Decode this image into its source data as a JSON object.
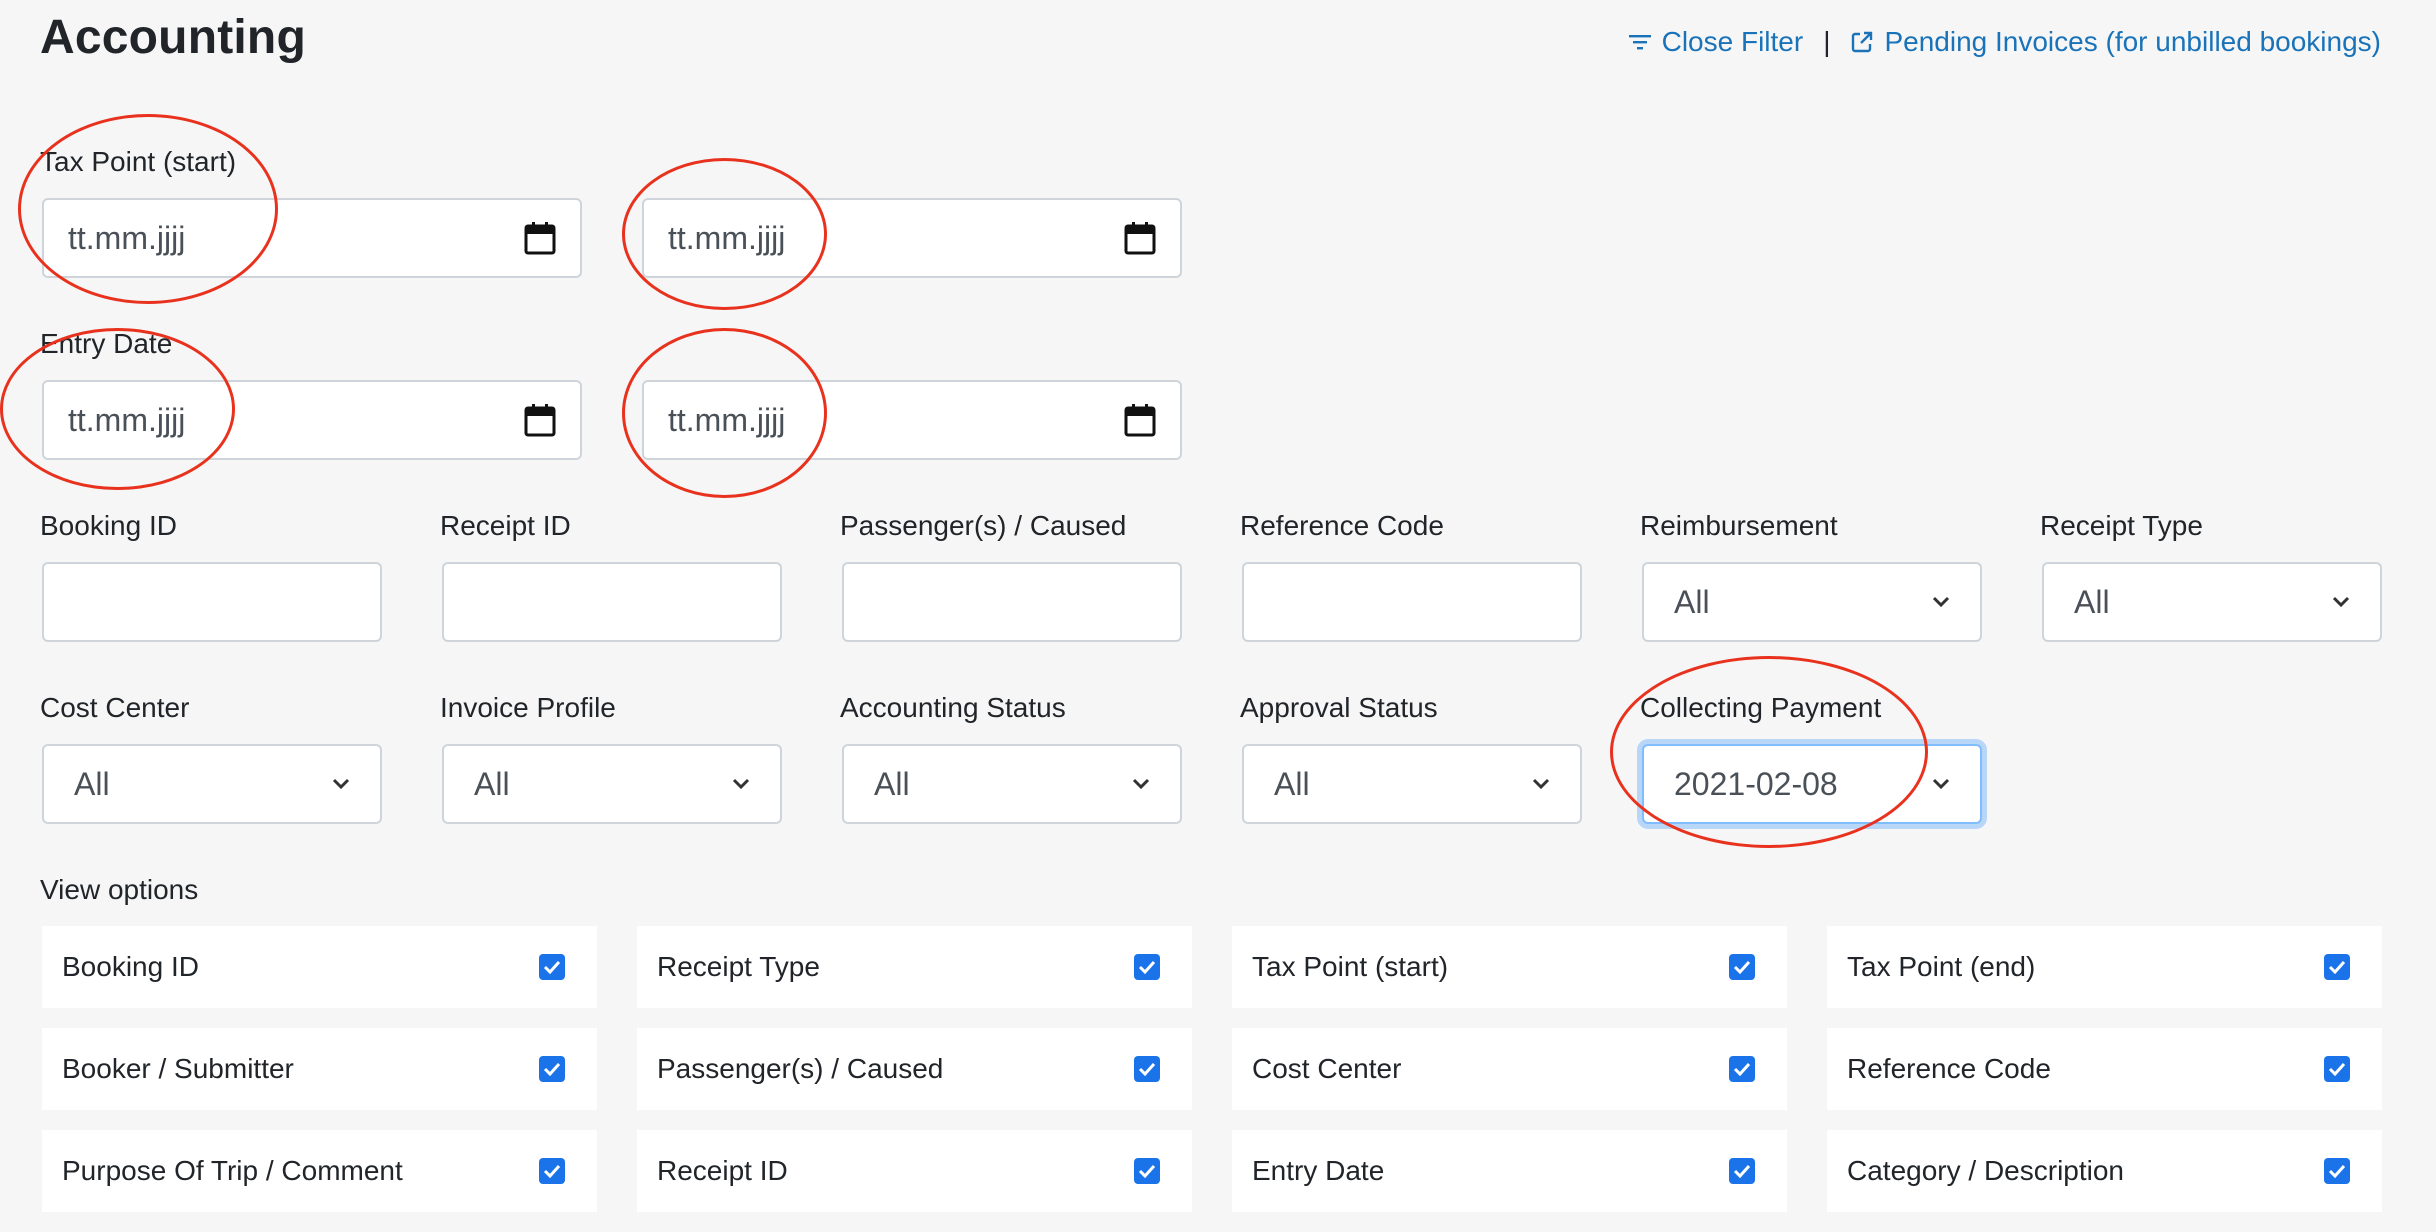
{
  "page": {
    "title": "Accounting",
    "close_filter": "Close Filter",
    "separator": "|",
    "pending_invoices": "Pending Invoices (for unbilled bookings)"
  },
  "filters": {
    "tax_point": {
      "label": "Tax Point (start)",
      "start_placeholder": "tt.mm.jjjj",
      "end_placeholder": "tt.mm.jjjj"
    },
    "entry_date": {
      "label": "Entry Date",
      "start_placeholder": "tt.mm.jjjj",
      "end_placeholder": "tt.mm.jjjj"
    },
    "text_fields": [
      {
        "label": "Booking ID",
        "value": ""
      },
      {
        "label": "Receipt ID",
        "value": ""
      },
      {
        "label": "Passenger(s) / Caused",
        "value": ""
      },
      {
        "label": "Reference Code",
        "value": ""
      }
    ],
    "reimbursement": {
      "label": "Reimbursement",
      "value": "All"
    },
    "receipt_type": {
      "label": "Receipt Type",
      "value": "All"
    },
    "cost_center": {
      "label": "Cost Center",
      "value": "All"
    },
    "invoice_profile": {
      "label": "Invoice Profile",
      "value": "All"
    },
    "accounting_status": {
      "label": "Accounting Status",
      "value": "All"
    },
    "approval_status": {
      "label": "Approval Status",
      "value": "All"
    },
    "collecting_payment": {
      "label": "Collecting Payment",
      "value": "2021-02-08"
    }
  },
  "view_options": {
    "label": "View options",
    "items": [
      {
        "label": "Booking ID",
        "checked": true
      },
      {
        "label": "Receipt Type",
        "checked": true
      },
      {
        "label": "Tax Point (start)",
        "checked": true
      },
      {
        "label": "Tax Point (end)",
        "checked": true
      },
      {
        "label": "Booker / Submitter",
        "checked": true
      },
      {
        "label": "Passenger(s) / Caused",
        "checked": true
      },
      {
        "label": "Cost Center",
        "checked": true
      },
      {
        "label": "Reference Code",
        "checked": true
      },
      {
        "label": "Purpose Of Trip / Comment",
        "checked": true
      },
      {
        "label": "Receipt ID",
        "checked": true
      },
      {
        "label": "Entry Date",
        "checked": true
      },
      {
        "label": "Category / Description",
        "checked": true
      }
    ]
  },
  "colors": {
    "link": "#1a73b8",
    "checkbox": "#1a73e8",
    "annotation": "#e8321e",
    "background": "#f6f6f6"
  },
  "icons": {
    "filter": "filter-lines-icon",
    "external": "external-link-icon",
    "calendar": "calendar-icon",
    "chevron": "chevron-down-icon",
    "check": "checkmark-icon"
  }
}
